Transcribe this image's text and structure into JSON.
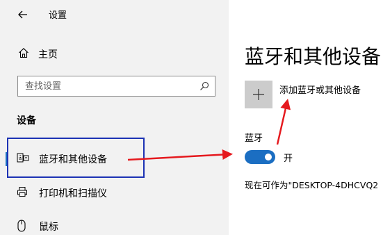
{
  "window": {
    "title": "设置"
  },
  "sidebar": {
    "home_label": "主页",
    "search_placeholder": "查找设置",
    "section_title": "设备",
    "items": [
      {
        "label": "蓝牙和其他设备",
        "icon": "keyboard-icon",
        "active": true
      },
      {
        "label": "打印机和扫描仪",
        "icon": "printer-icon",
        "active": false
      },
      {
        "label": "鼠标",
        "icon": "mouse-icon",
        "active": false
      }
    ]
  },
  "main": {
    "title": "蓝牙和其他设备",
    "add_label": "添加蓝牙或其他设备",
    "bluetooth_label": "蓝牙",
    "toggle_state": "开",
    "toggle_on": true,
    "discoverable_text": "现在可作为\"DESKTOP-4DHCVQ2"
  },
  "colors": {
    "accent": "#1b6ec2",
    "sidebar_bg": "#f2f2f2",
    "annotation_box": "#1c32b4",
    "annotation_arrow": "#e5191e"
  }
}
